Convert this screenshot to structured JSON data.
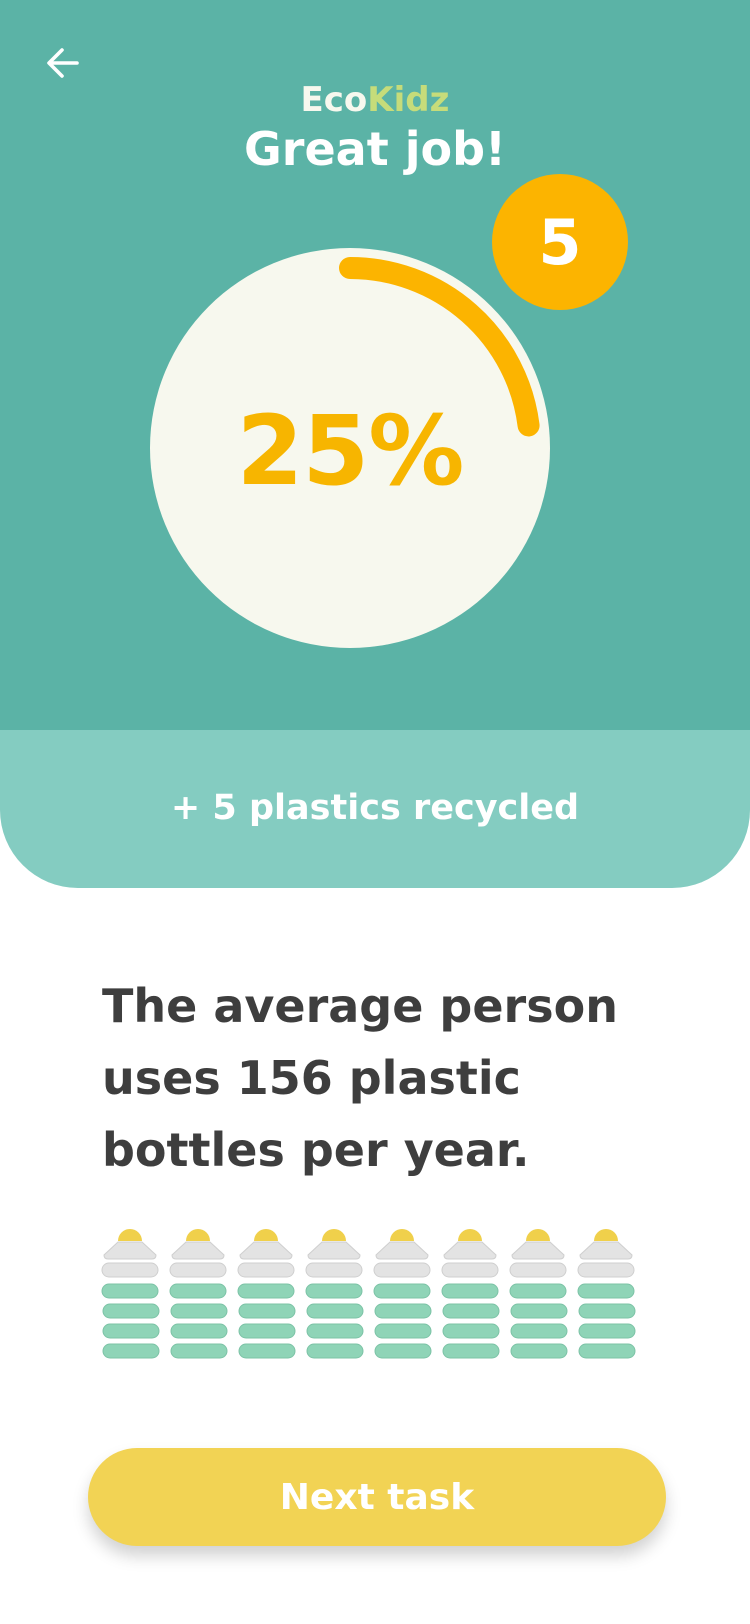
{
  "header": {
    "back_icon": "arrow-left-icon",
    "brand_part1": "Eco",
    "brand_part2": "Kidz",
    "title": "Great job!"
  },
  "progress": {
    "percent_label": "25%",
    "fraction": 0.25,
    "badge_count": "5",
    "track_color": "#f7f8ee",
    "arc_color": "#fcb400"
  },
  "recycled": {
    "text": "+ 5 plastics recycled"
  },
  "fact": {
    "text": "The average person uses 156 plastic bottles per year."
  },
  "bottles": {
    "count": 8,
    "cap_color": "#f0d04b",
    "neck_color": "#e3e3e3",
    "body_color": "#8fd4b7"
  },
  "cta": {
    "label": "Next task"
  }
}
